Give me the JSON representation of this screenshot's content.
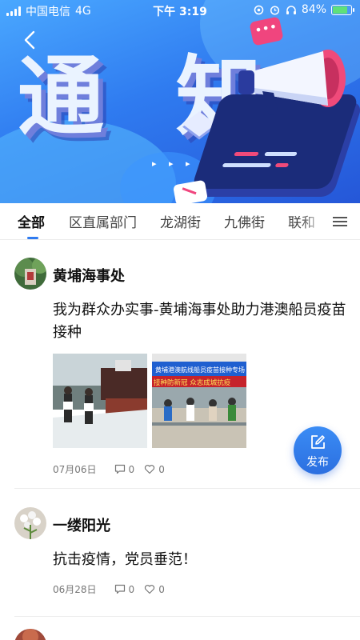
{
  "status_bar": {
    "carrier": "中国电信",
    "network": "4G",
    "time": "下午 3:19",
    "battery": "84%",
    "battery_level": 0.84,
    "battery_color": "#5fe07a"
  },
  "banner": {
    "title": "通 知",
    "back_icon": "chevron-left-icon",
    "dots": "▸ ▸ ▸"
  },
  "tabs": {
    "items": [
      {
        "label": "全部",
        "active": true
      },
      {
        "label": "区直属部门",
        "active": false
      },
      {
        "label": "龙湖街",
        "active": false
      },
      {
        "label": "九佛街",
        "active": false
      },
      {
        "label": "联和",
        "active": false
      }
    ],
    "menu_icon": "hamburger-menu-icon",
    "accent": "#2f7bf0"
  },
  "posts": [
    {
      "author": "黄埔海事处",
      "title": "我为群众办实事-黄埔海事处助力港澳船员疫苗接种",
      "images": [
        {
          "desc_icon": "photo-ship-deck"
        },
        {
          "banner_text": "黄埔港澳航线船员疫苗接种专场",
          "slogan": "接种防新冠 众志成城抗疫"
        }
      ],
      "date": "07月06日",
      "comments": "0",
      "likes": "0"
    },
    {
      "author": "一缕阳光",
      "title": "抗击疫情，党员垂范！",
      "date": "06月28日",
      "comments": "0",
      "likes": "0"
    }
  ],
  "fab": {
    "label": "发布",
    "icon": "edit-icon",
    "color": "#2f7bf0"
  }
}
